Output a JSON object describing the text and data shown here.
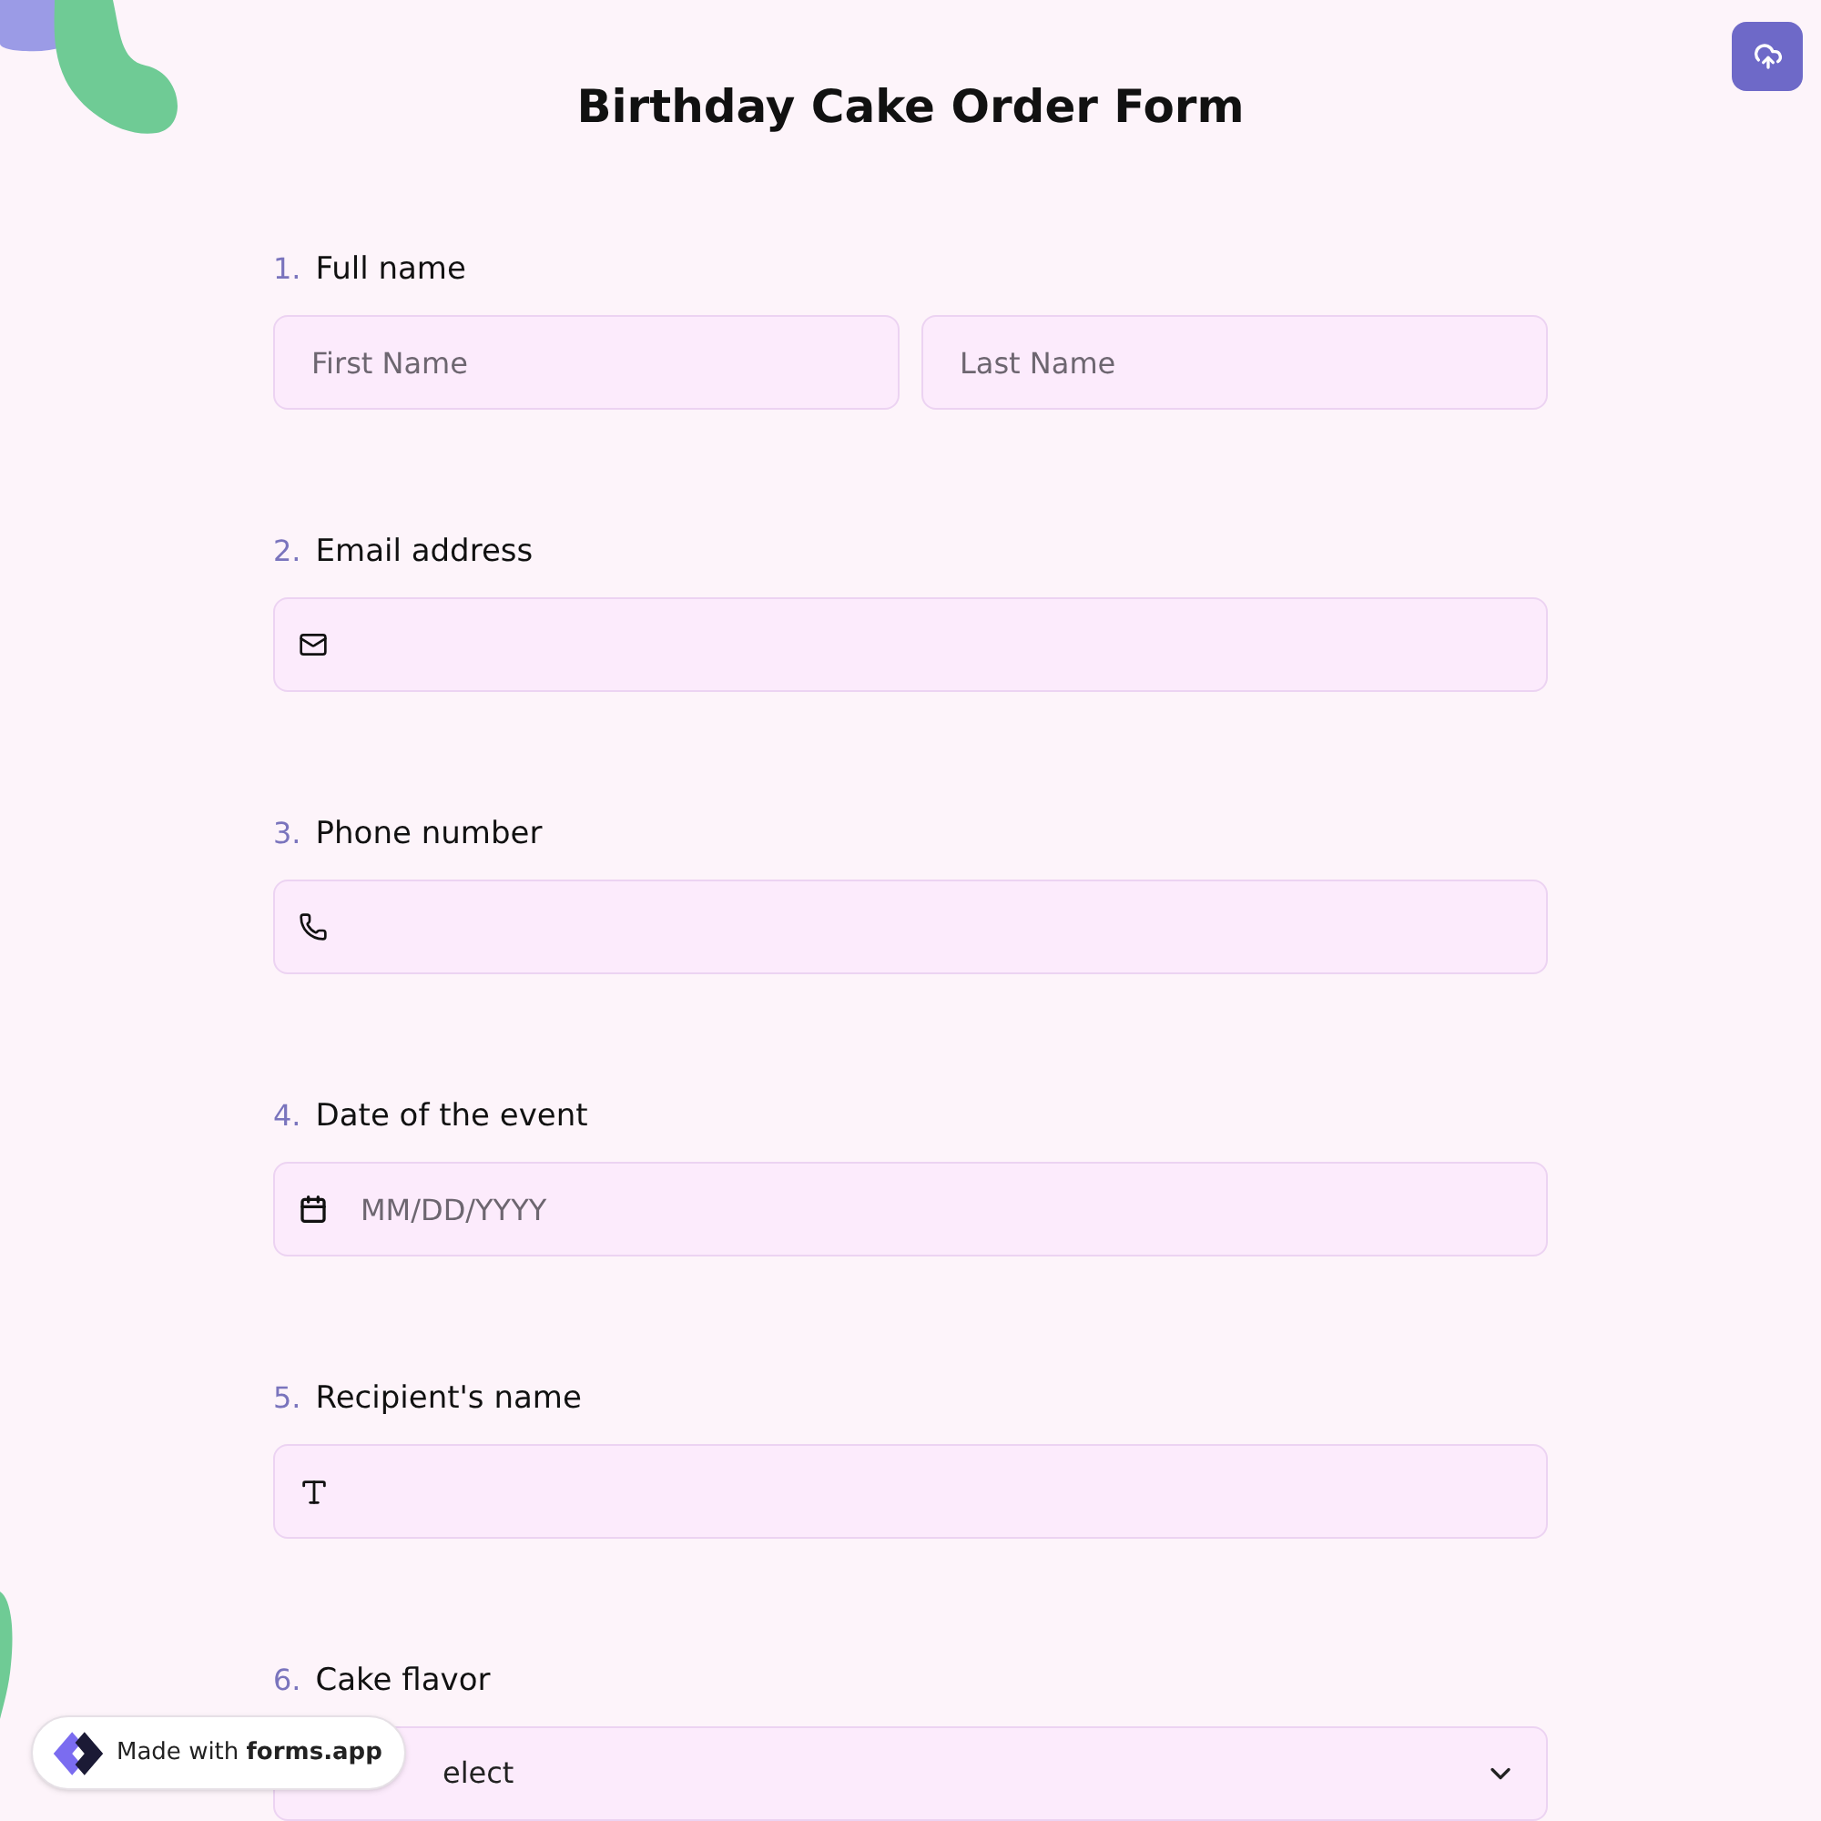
{
  "title": "Birthday Cake Order Form",
  "questions": [
    {
      "number": "1.",
      "label": "Full name",
      "kind": "name",
      "fields": [
        {
          "placeholder": "First Name"
        },
        {
          "placeholder": "Last Name"
        }
      ]
    },
    {
      "number": "2.",
      "label": "Email address",
      "kind": "email"
    },
    {
      "number": "3.",
      "label": "Phone number",
      "kind": "phone"
    },
    {
      "number": "4.",
      "label": "Date of the event",
      "kind": "date",
      "placeholder": "MM/DD/YYYY"
    },
    {
      "number": "5.",
      "label": "Recipient's name",
      "kind": "text"
    },
    {
      "number": "6.",
      "label": "Cake flavor",
      "kind": "select",
      "placeholder": "elect"
    }
  ],
  "badge": {
    "prefix": "Made with ",
    "brand": "forms.app"
  }
}
